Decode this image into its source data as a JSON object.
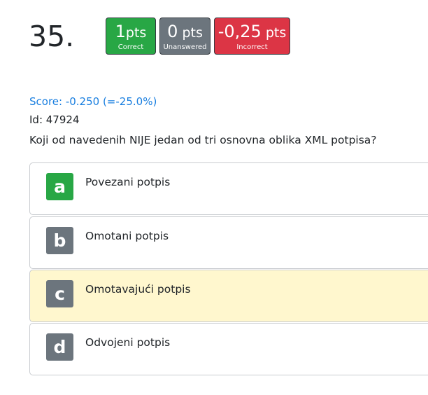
{
  "question": {
    "number": "35.",
    "score_text": "Score: -0.250 (=-25.0%)",
    "id_text": "Id: 47924",
    "text": "Koji od navedenih NIJE jedan od tri osnovna oblika XML potpisa?"
  },
  "badges": {
    "correct": {
      "value": "1",
      "unit": "pts",
      "caption": "Correct",
      "color": "#28a745"
    },
    "unanswered": {
      "value": "0",
      "unit": "pts",
      "caption": "Unanswered",
      "color": "#6c757d"
    },
    "incorrect": {
      "value": "-0,25",
      "unit": "pts",
      "caption": "Incorrect",
      "color": "#dc3545"
    }
  },
  "options": [
    {
      "letter": "a",
      "text": "Povezani potpis",
      "state": "correct",
      "letter_color": "#28a745"
    },
    {
      "letter": "b",
      "text": "Omotani potpis",
      "state": "normal",
      "letter_color": "#6c757d"
    },
    {
      "letter": "c",
      "text": "Omotavajući potpis",
      "state": "selected",
      "letter_color": "#6c757d",
      "highlight_color": "#fff7ce"
    },
    {
      "letter": "d",
      "text": "Odvojeni potpis",
      "state": "normal",
      "letter_color": "#6c757d"
    }
  ]
}
